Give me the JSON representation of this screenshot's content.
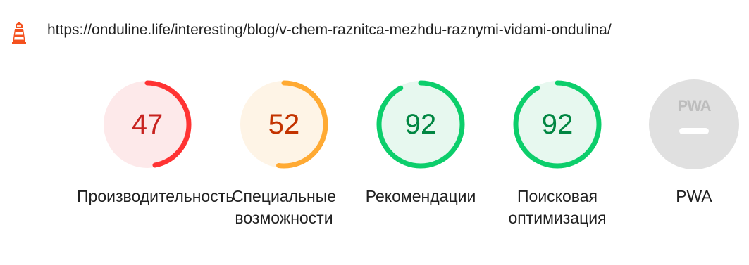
{
  "url_bar": {
    "url": "https://onduline.life/interesting/blog/v-chem-raznitca-mezhdu-raznymi-vidami-ondulina/",
    "icon": "lighthouse-icon"
  },
  "gauges": [
    {
      "score": "47",
      "score_value": 47,
      "label_line1": "Производительность",
      "label_line2": "",
      "color": "#ff3333",
      "score_color": "#c7221f",
      "bg_color": "#fde9ea"
    },
    {
      "score": "52",
      "score_value": 52,
      "label_line1": "Специальные",
      "label_line2": "возможности",
      "color": "#ffaa33",
      "score_color": "#c33300",
      "bg_color": "#fef4e6"
    },
    {
      "score": "92",
      "score_value": 92,
      "label_line1": "Рекомендации",
      "label_line2": "",
      "color": "#0cce6b",
      "score_color": "#018642",
      "bg_color": "#e7f8ef"
    },
    {
      "score": "92",
      "score_value": 92,
      "label_line1": "Поисковая",
      "label_line2": "оптимизация",
      "color": "#0cce6b",
      "score_color": "#018642",
      "bg_color": "#e7f8ef"
    }
  ],
  "pwa": {
    "badge_text": "PWA",
    "label": "PWA",
    "bg_color": "#e0e0e0",
    "icon": "pwa-badge-icon"
  }
}
